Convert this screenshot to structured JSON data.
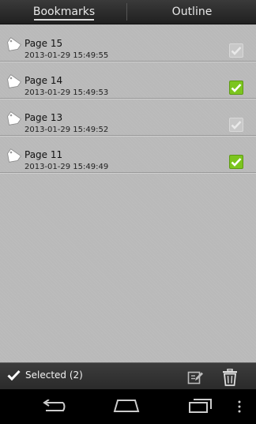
{
  "tabs": [
    {
      "label": "Bookmarks",
      "active": true
    },
    {
      "label": "Outline",
      "active": false
    }
  ],
  "bookmarks": [
    {
      "title": "Page 15",
      "date": "2013-01-29 15:49:55",
      "checked": false
    },
    {
      "title": "Page 14",
      "date": "2013-01-29 15:49:53",
      "checked": true
    },
    {
      "title": "Page 13",
      "date": "2013-01-29 15:49:52",
      "checked": false
    },
    {
      "title": "Page 11",
      "date": "2013-01-29 15:49:49",
      "checked": true
    }
  ],
  "actionbar": {
    "selected_label": "Selected (2)"
  },
  "icons": {
    "tag": "bookmark-tag-icon",
    "check": "checkmark-icon",
    "edit": "edit-icon",
    "trash": "trash-icon",
    "back": "back-icon",
    "home": "home-icon",
    "recents": "recent-apps-icon",
    "menu": "overflow-menu-icon"
  },
  "colors": {
    "check_on": "#7cc51f",
    "list_bg": "#b9b9b9",
    "bar_bg": "#2f2f2f"
  }
}
